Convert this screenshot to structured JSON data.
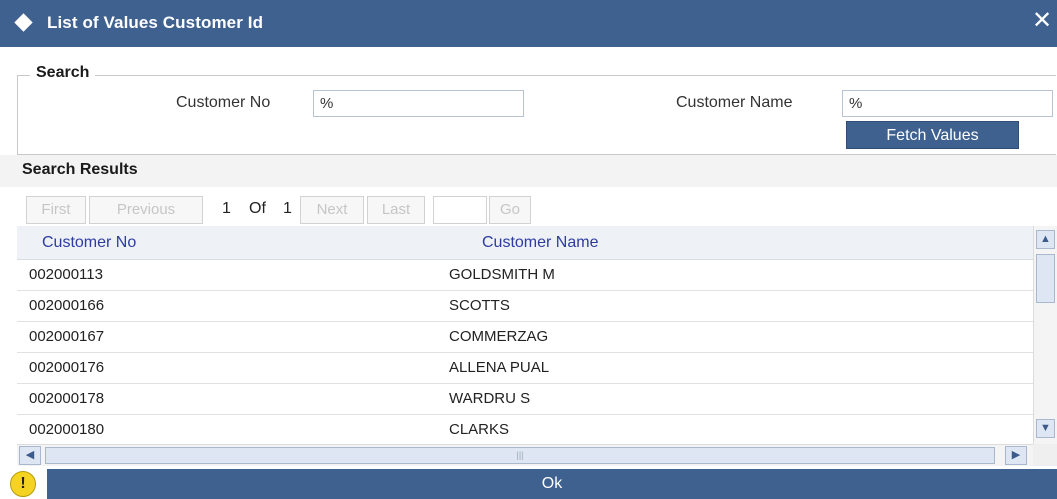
{
  "window": {
    "title": "List of Values Customer Id",
    "close_glyph": "✕",
    "icon": "diamond-icon"
  },
  "search": {
    "legend": "Search",
    "customer_no_label": "Customer No",
    "customer_no_value": "%",
    "customer_name_label": "Customer Name",
    "customer_name_value": "%",
    "fetch_button": "Fetch Values"
  },
  "results": {
    "title": "Search Results",
    "pager": {
      "first": "First",
      "previous": "Previous",
      "page_current": "1",
      "of_label": "Of",
      "page_total": "1",
      "next": "Next",
      "last": "Last",
      "goto_value": "",
      "go": "Go"
    },
    "columns": [
      "Customer No",
      "Customer Name"
    ],
    "rows": [
      {
        "customer_no": "002000113",
        "customer_name": "GOLDSMITH M"
      },
      {
        "customer_no": "002000166",
        "customer_name": "SCOTTS"
      },
      {
        "customer_no": "002000167",
        "customer_name": "COMMERZAG"
      },
      {
        "customer_no": "002000176",
        "customer_name": "ALLENA PUAL"
      },
      {
        "customer_no": "002000178",
        "customer_name": "WARDRU S"
      },
      {
        "customer_no": "002000180",
        "customer_name": "CLARKS"
      }
    ]
  },
  "footer": {
    "ok_button": "Ok",
    "warning_glyph": "!"
  },
  "colors": {
    "title_bar": "#3f6190",
    "button": "#3f6190",
    "column_header_text": "#2d3c9e",
    "warning": "#f5d322"
  }
}
